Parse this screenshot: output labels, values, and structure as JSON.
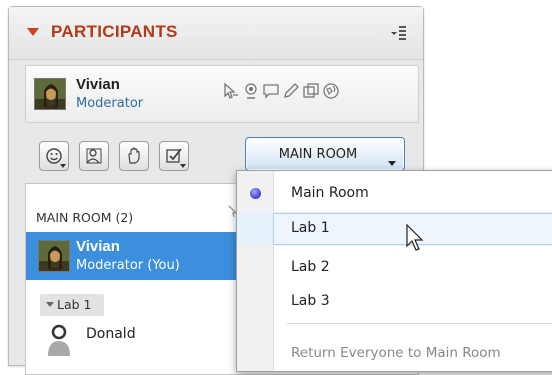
{
  "panel": {
    "title": "PARTICIPANTS",
    "me": {
      "name": "Vivian",
      "role": "Moderator"
    },
    "toolbar": {
      "room_button_label": "MAIN ROOM"
    },
    "list": {
      "room_heading": "MAIN ROOM (2)",
      "selected": {
        "name": "Vivian",
        "role": "Moderator (You)"
      },
      "group_label": "Lab 1",
      "participant": "Donald"
    }
  },
  "dropdown": {
    "items": [
      {
        "label": "Main Room",
        "checked": true
      },
      {
        "label": "Lab 1",
        "hovered": true
      },
      {
        "label": "Lab 2"
      },
      {
        "label": "Lab 3"
      }
    ],
    "return_label": "Return Everyone to Main Room"
  },
  "colors": {
    "title": "#b23a17",
    "selected_row": "#3b8fdc",
    "role_text": "#2d6da5",
    "room_button_border": "#4a80b4"
  }
}
